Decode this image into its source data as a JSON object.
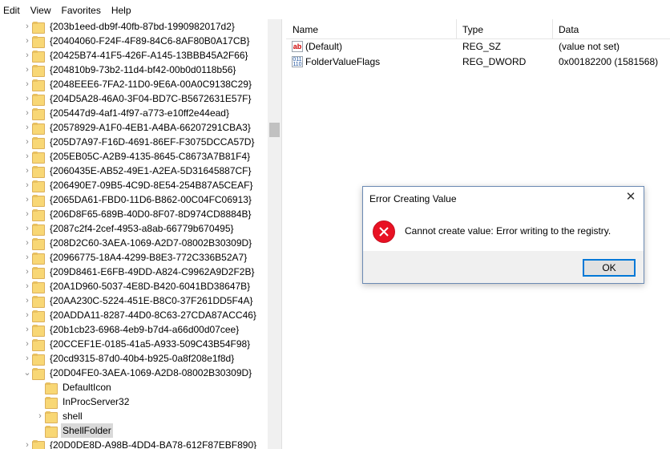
{
  "menu": [
    "Edit",
    "View",
    "Favorites",
    "Help"
  ],
  "tree": {
    "keys": [
      "{203b1eed-db9f-40fb-87bd-1990982017d2}",
      "{20404060-F24F-4F89-84C6-8AF80B0A17CB}",
      "{20425B74-41F5-426F-A145-13BBB45A2F66}",
      "{204810b9-73b2-11d4-bf42-00b0d0118b56}",
      "{2048EEE6-7FA2-11D0-9E6A-00A0C9138C29}",
      "{204D5A28-46A0-3F04-BD7C-B5672631E57F}",
      "{205447d9-4af1-4f97-a773-e10ff2e44ead}",
      "{20578929-A1F0-4EB1-A4BA-66207291CBA3}",
      "{205D7A97-F16D-4691-86EF-F3075DCCA57D}",
      "{205EB05C-A2B9-4135-8645-C8673A7B81F4}",
      "{2060435E-AB52-49E1-A2EA-5D31645887CF}",
      "{206490E7-09B5-4C9D-8E54-254B87A5CEAF}",
      "{2065DA61-FBD0-11D6-B862-00C04FC06913}",
      "{206D8F65-689B-40D0-8F07-8D974CD8884B}",
      "{2087c2f4-2cef-4953-a8ab-66779b670495}",
      "{208D2C60-3AEA-1069-A2D7-08002B30309D}",
      "{20966775-18A4-4299-B8E3-772C336B52A7}",
      "{209D8461-E6FB-49DD-A824-C9962A9D2F2B}",
      "{20A1D960-5037-4E8D-B420-6041BD38647B}",
      "{20AA230C-5224-451E-B8C0-37F261DD5F4A}",
      "{20ADDA11-8287-44D0-8C63-27CDA87ACC46}",
      "{20b1cb23-6968-4eb9-b7d4-a66d00d07cee}",
      "{20CCEF1E-0185-41a5-A933-509C43B54F98}",
      "{20cd9315-87d0-40b4-b925-0a8f208e1f8d}"
    ],
    "expanded_key": "{20D04FE0-3AEA-1069-A2D8-08002B30309D}",
    "children": [
      "DefaultIcon",
      "InProcServer32",
      "shell",
      "ShellFolder"
    ],
    "selected_child": "ShellFolder",
    "last_key": "{20D0DE8D-A98B-4DD4-BA78-612F87EBF890}"
  },
  "list": {
    "columns": [
      "Name",
      "Type",
      "Data"
    ],
    "rows": [
      {
        "name": "(Default)",
        "type": "REG_SZ",
        "data": "(value not set)",
        "icon": "string-value-icon"
      },
      {
        "name": "FolderValueFlags",
        "type": "REG_DWORD",
        "data": "0x00182200 (1581568)",
        "icon": "binary-value-icon"
      }
    ]
  },
  "dialog": {
    "title": "Error Creating Value",
    "message": "Cannot create value: Error writing to the registry.",
    "ok_label": "OK",
    "close_glyph": "✕"
  },
  "icons": {
    "ab_glyph": "ab",
    "bin_glyph": "011\n110"
  }
}
